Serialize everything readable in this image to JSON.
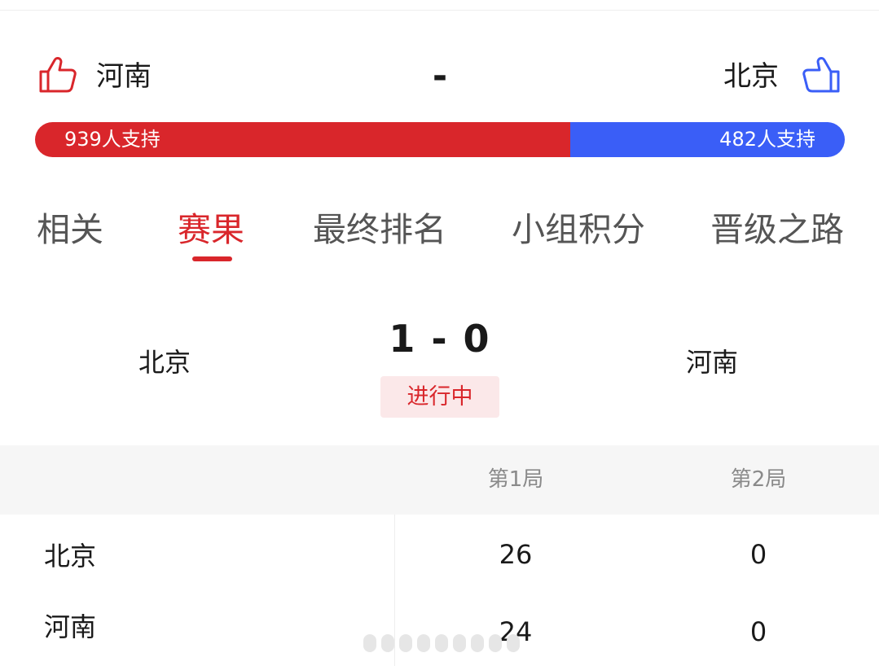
{
  "header": {
    "home_team": "河南",
    "away_team": "北京",
    "vs_separator": "-"
  },
  "support": {
    "home_label": "939人支持",
    "away_label": "482人支持",
    "home_count": 939,
    "away_count": 482,
    "home_color": "#d9262b",
    "away_color": "#3a5ef7",
    "home_icon": "thumbs-up-icon",
    "away_icon": "thumbs-up-icon"
  },
  "tabs": [
    {
      "label": "相关",
      "active": false
    },
    {
      "label": "赛果",
      "active": true
    },
    {
      "label": "最终排名",
      "active": false
    },
    {
      "label": "小组积分",
      "active": false
    },
    {
      "label": "晋级之路",
      "active": false
    }
  ],
  "match": {
    "left_team": "北京",
    "right_team": "河南",
    "score": "1 - 0",
    "status": "进行中"
  },
  "score_table": {
    "headers": [
      "第1局",
      "第2局"
    ],
    "rows": [
      {
        "team": "北京",
        "sets": [
          "26",
          "0"
        ]
      },
      {
        "team": "河南",
        "sets": [
          "24",
          "0"
        ]
      }
    ]
  }
}
